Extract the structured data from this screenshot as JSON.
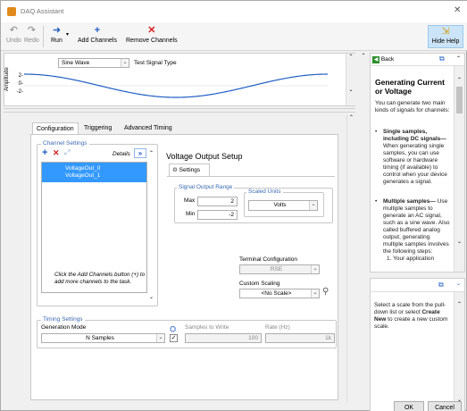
{
  "window": {
    "title": "DAQ Assistant",
    "close_glyph": "✕"
  },
  "toolbar": {
    "undo": "Undo",
    "redo": "Redo",
    "run": "Run",
    "add_channels": "Add Channels",
    "remove_channels": "Remove Channels",
    "hide_help": "Hide Help"
  },
  "plot": {
    "signal_select": "Sine Wave",
    "signal_label": "Test Signal Type",
    "ylabel": "Amplitude",
    "yticks": [
      "2-",
      "0-",
      "-2-"
    ]
  },
  "tabs": [
    "Configuration",
    "Triggering",
    "Advanced Timing"
  ],
  "channel_settings": {
    "title": "Channel Settings",
    "details": "Details",
    "channels": [
      "VoltageOut_0",
      "VoltageOut_1"
    ],
    "hint": "Click the Add Channels button (+) to add more channels to the task."
  },
  "voltage_setup": {
    "title": "Voltage Output Setup",
    "settings_tab": "Settings",
    "range_caption": "Signal Output Range",
    "max_label": "Max",
    "max_value": "2",
    "min_label": "Min",
    "min_value": "-2",
    "units_caption": "Scaled Units",
    "units_value": "Volts",
    "terminal_label": "Terminal Configuration",
    "terminal_value": "RSE",
    "scaling_label": "Custom Scaling",
    "scaling_value": "<No Scale>"
  },
  "timing": {
    "title": "Timing Settings",
    "gen_mode_label": "Generation Mode",
    "gen_mode_value": "N Samples",
    "samples_label": "Samples to Write",
    "samples_value": "100",
    "rate_label": "Rate (Hz)",
    "rate_value": "1k"
  },
  "help": {
    "back": "Back",
    "heading": "Generating Current or Voltage",
    "intro": "You can generate two main kinds of signals for channels:",
    "b1_title": "Single samples, including DC signals—",
    "b1_text": "When generating single samples, you can use software or hardware timing (if available) to control when your device generates a signal.",
    "b2_title": "Multiple samples—",
    "b2_text": "Use multiple samples to generate an AC signal, such as a sine wave. Also called buffered analog output, generating multiple samples involves the following steps:",
    "step1": "1.  Your application",
    "lower_pre": "Select a scale from the pull-down list or select ",
    "lower_bold": "Create New",
    "lower_post": " to create a new custom scale."
  },
  "footer": {
    "ok": "OK",
    "cancel": "Cancel"
  },
  "colors": {
    "accent": "#1f5cc4",
    "selection": "#3399ff",
    "caption": "#3a6ab0",
    "remove": "#d82020"
  }
}
